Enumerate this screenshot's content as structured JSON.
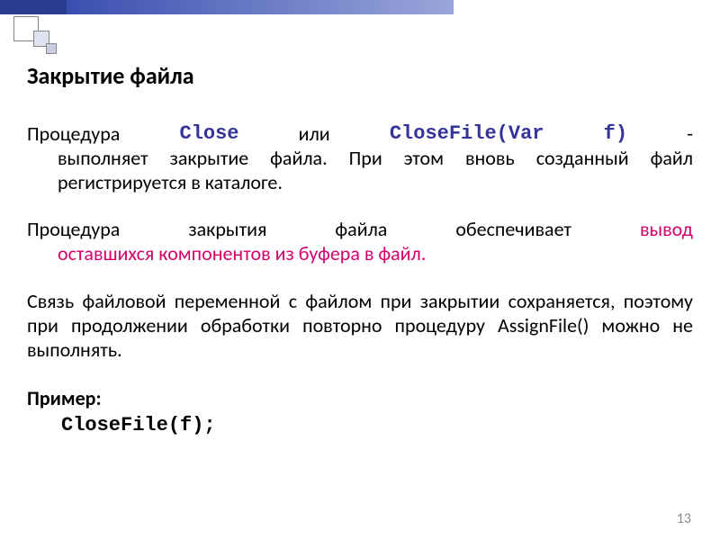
{
  "title": "Закрытие файла",
  "p1": {
    "lead": "Процедура",
    "kw1": "Close",
    "or": "или",
    "kw2": "CloseFile(Var",
    "kw3": "f)",
    "dash": "-",
    "rest": "выполняет закрытие файла. При этом вновь созданный файл регистрируется в каталоге."
  },
  "p2": {
    "a1": "Процедура",
    "a2": "закрытия",
    "a3": "файла",
    "a4": "обеспечивает",
    "hl1": "вывод",
    "hl_rest": "оставшихся компонентов из буфера в файл."
  },
  "p3": "Связь файловой переменной с файлом при закрытии сохраняется, поэтому при продолжении обработки повторно процедуру AssignFile() можно не выполнять.",
  "example_label": "Пример:",
  "example_code": "CloseFile(f);",
  "page_number": "13"
}
